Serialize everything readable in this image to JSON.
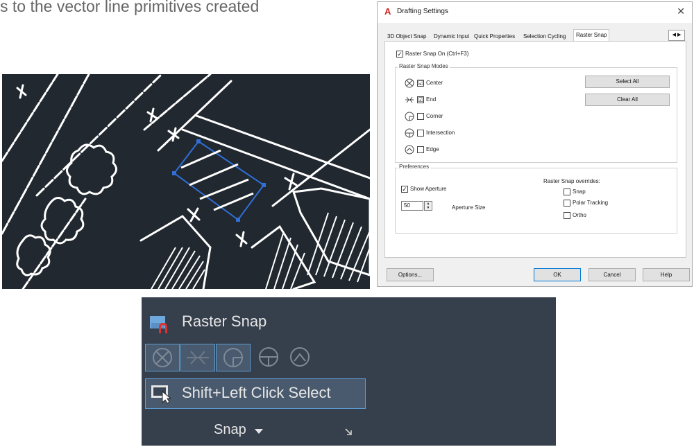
{
  "intro_text": "s to the vector line primitives created",
  "dialog": {
    "title": "Drafting Settings",
    "close_icon": "close-icon",
    "tabs": [
      "3D Object Snap",
      "Dynamic Input",
      "Quick Properties",
      "Selection Cycling",
      "Raster Snap"
    ],
    "active_tab": "Raster Snap",
    "raster_snap_on_label": "Raster Snap On (Ctrl+F3)",
    "modes_title": "Raster Snap Modes",
    "modes": [
      {
        "label": "Center",
        "checked": "☑"
      },
      {
        "label": "End",
        "checked": "☑"
      },
      {
        "label": "Corner",
        "checked": ""
      },
      {
        "label": "Intersection",
        "checked": ""
      },
      {
        "label": "Edge",
        "checked": ""
      }
    ],
    "select_all": "Select All",
    "clear_all": "Clear All",
    "preferences_title": "Preferences",
    "show_aperture_label": "Show Aperture",
    "aperture_value": "50",
    "aperture_size_label": "Aperture Size",
    "overrides_title": "Raster Snap overrides:",
    "overrides": [
      "Snap",
      "Polar Tracking",
      "Ortho"
    ],
    "buttons": {
      "options": "Options...",
      "ok": "OK",
      "cancel": "Cancel",
      "help": "Help"
    }
  },
  "ribbon": {
    "title": "Raster Snap",
    "shift_select": "Shift+Left Click Select",
    "snap_label": "Snap"
  },
  "colors": {
    "cad_background": "#212830",
    "ribbon_background": "#363f4c",
    "selection_blue": "#2f6fd6",
    "accent_highlight": "#5d9cd2"
  }
}
